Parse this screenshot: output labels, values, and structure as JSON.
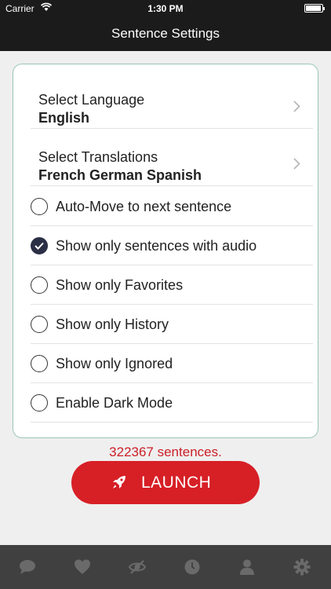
{
  "status_bar": {
    "carrier": "Carrier",
    "time": "1:30 PM"
  },
  "nav": {
    "title": "Sentence Settings"
  },
  "settings": {
    "language": {
      "label": "Select Language",
      "value": "English"
    },
    "translations": {
      "label": "Select Translations",
      "value": "French German Spanish"
    },
    "options": [
      {
        "label": "Auto-Move to next sentence",
        "checked": false
      },
      {
        "label": "Show only sentences with audio",
        "checked": true
      },
      {
        "label": "Show only Favorites",
        "checked": false
      },
      {
        "label": "Show only History",
        "checked": false
      },
      {
        "label": "Show only Ignored",
        "checked": false
      },
      {
        "label": "Enable Dark Mode",
        "checked": false
      }
    ]
  },
  "sentence_count": "322367 sentences.",
  "launch_button": {
    "label": "LAUNCH",
    "icon": "rocket-icon"
  },
  "tab_bar": {
    "tabs": [
      {
        "icon": "chat-bubble-icon"
      },
      {
        "icon": "heart-icon"
      },
      {
        "icon": "eye-slash-icon"
      },
      {
        "icon": "history-clock-icon"
      },
      {
        "icon": "person-icon"
      },
      {
        "icon": "gear-icon"
      }
    ]
  },
  "colors": {
    "accent_red": "#d71f26",
    "count_red": "#cc1f27",
    "card_border": "#9bc6b7",
    "checked_radio": "#2b2f45",
    "tab_bar_bg": "#404040",
    "tab_icon": "#6a6a6a"
  }
}
